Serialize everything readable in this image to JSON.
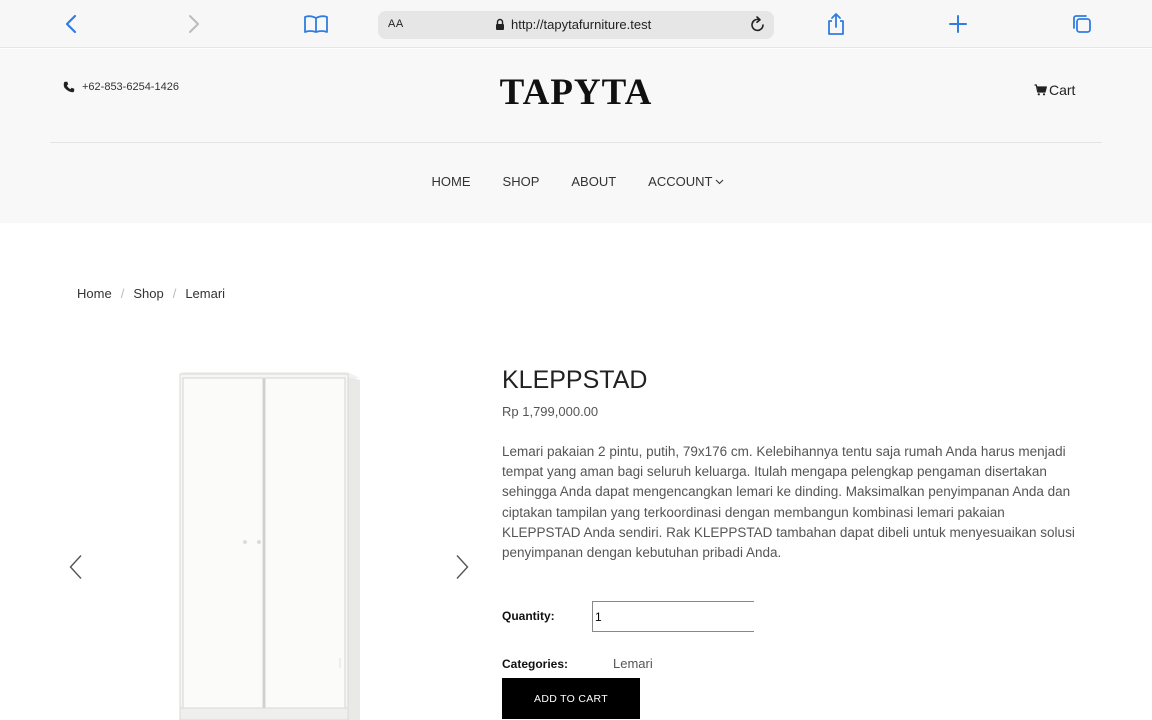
{
  "browser": {
    "text_size_label": "AA",
    "url": "http://tapytafurniture.test",
    "icons": [
      "back-icon",
      "forward-icon",
      "bookmarks-icon",
      "lock-icon",
      "reload-icon",
      "share-icon",
      "new-tab-icon",
      "tabs-icon"
    ]
  },
  "header": {
    "phone": "+62-853-6254-1426",
    "logo": "TAPYTA",
    "cart_label": "Cart"
  },
  "nav": {
    "items": [
      "HOME",
      "SHOP",
      "ABOUT",
      "ACCOUNT"
    ]
  },
  "breadcrumb": {
    "items": [
      "Home",
      "Shop",
      "Lemari"
    ],
    "separator": "/"
  },
  "product": {
    "name": "KLEPPSTAD",
    "price": "Rp 1,799,000.00",
    "description": "Lemari pakaian 2 pintu, putih, 79x176 cm. Kelebihannya tentu saja rumah Anda harus menjadi tempat yang aman bagi seluruh keluarga. Itulah mengapa pelengkap pengaman disertakan sehingga Anda dapat mengencangkan lemari ke dinding. Maksimalkan penyimpanan Anda dan ciptakan tampilan yang terkoordinasi dengan membangun kombinasi lemari pakaian KLEPPSTAD Anda sendiri. Rak KLEPPSTAD tambahan dapat dibeli untuk menyesuaikan solusi penyimpanan dengan kebutuhan pribadi Anda.",
    "quantity_label": "Quantity:",
    "quantity_value": "1",
    "categories_label": "Categories:",
    "category": "Lemari",
    "add_to_cart_label": "ADD TO CART"
  },
  "colors": {
    "accent": "#3b82f6",
    "button_bg": "#000000",
    "header_bg": "#f8f8f8"
  }
}
